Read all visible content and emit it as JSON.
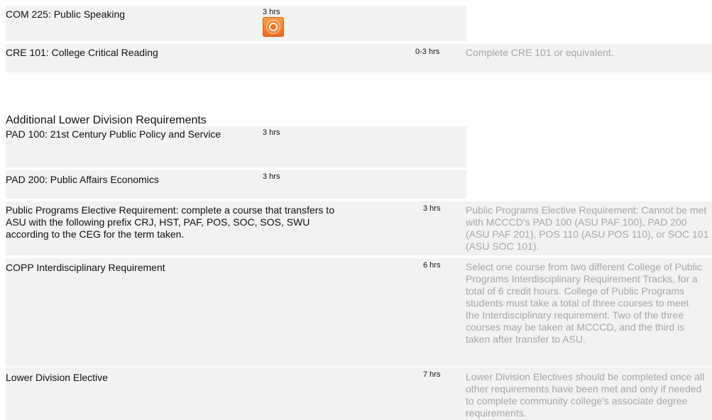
{
  "rows": [
    {
      "course": "COM 225: Public Speaking",
      "hours": "3 hrs",
      "note": ""
    },
    {
      "course": "CRE 101: College Critical Reading",
      "hours": "0-3 hrs",
      "note": "Complete CRE 101 or equivalent."
    },
    {
      "course": "PAD 100: 21st Century Public Policy and Service",
      "hours": "3 hrs",
      "note": ""
    },
    {
      "course": "PAD 200: Public Affairs Economics",
      "hours": "3 hrs",
      "note": ""
    },
    {
      "course": "Public Programs Elective Requirement: complete a course that transfers to ASU with the following prefix CRJ, HST, PAF, POS, SOC, SOS, SWU according to the CEG for the term taken.",
      "hours": "3 hrs",
      "note": "Public Programs Elective Requirement: Cannot be met with MCCCD's PAD 100 (ASU PAF 100), PAD 200 (ASU PAF 201), POS 110 (ASU POS 110), or SOC 101 (ASU SOC 101)."
    },
    {
      "course": "COPP Interdisciplinary Requirement",
      "hours": "6 hrs",
      "note": "Select one course from two different College of Public Programs Interdisciplinary Requirement Tracks, for a total of 6 credit hours. College of Public Programs students must take a total of three courses to meet the Interdisciplinary requirement. Two of the three courses may be taken at MCCCD, and the third is taken after transfer to ASU."
    },
    {
      "course": "Lower Division Elective",
      "hours": "7 hrs",
      "note": "Lower Division Electives should be completed once all other requirements have been met and only if needed to complete community college's associate degree requirements."
    }
  ],
  "section": {
    "title": "Additional Lower Division Requirements"
  },
  "icons": {
    "course_link": "course-link-icon"
  }
}
